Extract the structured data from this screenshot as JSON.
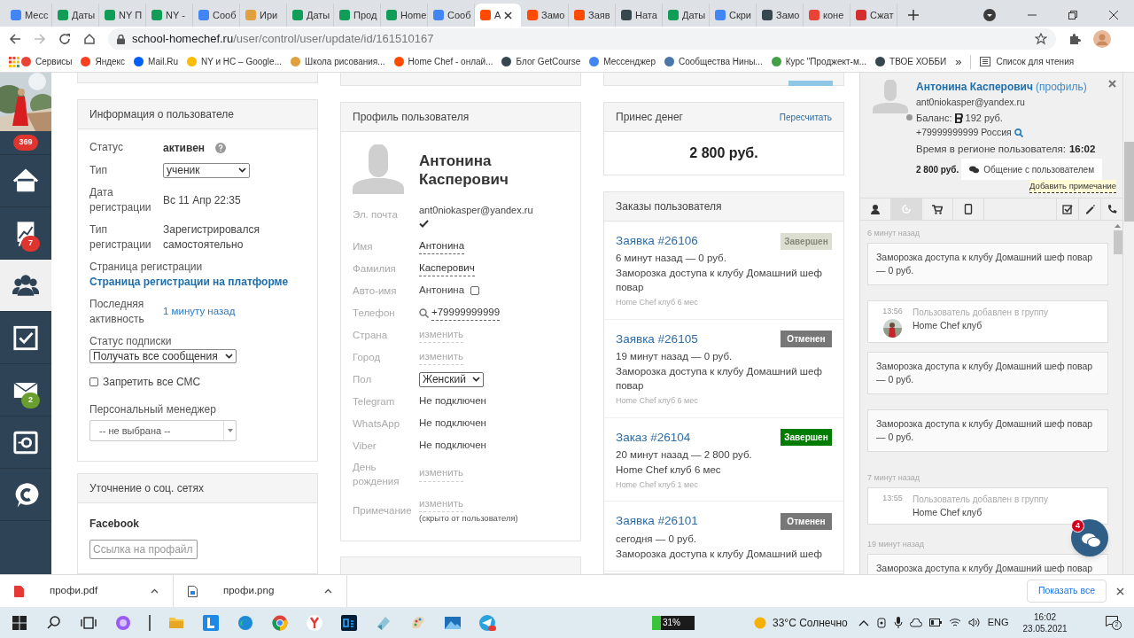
{
  "browser": {
    "tabs": [
      {
        "label": "Месс",
        "color": "#4285f4",
        "selected": false
      },
      {
        "label": "Даты",
        "color": "#0f9d58",
        "selected": false
      },
      {
        "label": "NY П",
        "color": "#0f9d58",
        "selected": false
      },
      {
        "label": "NY -",
        "color": "#0f9d58",
        "selected": false
      },
      {
        "label": "Сооб",
        "color": "#4285f4",
        "selected": false
      },
      {
        "label": "Ири",
        "color": "#e0a040",
        "selected": false
      },
      {
        "label": "Даты",
        "color": "#0f9d58",
        "selected": false
      },
      {
        "label": "Прод",
        "color": "#0f9d58",
        "selected": false
      },
      {
        "label": "Home",
        "color": "#0f9d58",
        "selected": false
      },
      {
        "label": "Сооб",
        "color": "#4285f4",
        "selected": false
      },
      {
        "label": "А",
        "color": "#ff4a00",
        "selected": true
      },
      {
        "label": "Замо",
        "color": "#ff4a00",
        "selected": false
      },
      {
        "label": "Заяв",
        "color": "#ff4a00",
        "selected": false
      },
      {
        "label": "Ната",
        "color": "#37474f",
        "selected": false
      },
      {
        "label": "Даты",
        "color": "#0f9d58",
        "selected": false
      },
      {
        "label": "Скри",
        "color": "#4285f4",
        "selected": false
      },
      {
        "label": "Замо",
        "color": "#37474f",
        "selected": false
      },
      {
        "label": "коне",
        "color": "#ea4335",
        "selected": false
      },
      {
        "label": "Сжат",
        "color": "#d32f2f",
        "selected": false
      }
    ],
    "url_host": "school-homechef.ru",
    "url_path": "/user/control/user/update/id/161510167",
    "bookmarks": [
      {
        "label": "Сервисы",
        "color": "#ea4335"
      },
      {
        "label": "Яндекс",
        "color": "#fc3f1d"
      },
      {
        "label": "Mail.Ru",
        "color": "#005ff9"
      },
      {
        "label": "NY и HC – Google...",
        "color": "#fbbc04"
      },
      {
        "label": "Школа рисования...",
        "color": "#e0a040"
      },
      {
        "label": "Home Chef - онлай...",
        "color": "#ff4a00"
      },
      {
        "label": "Блог GetCourse",
        "color": "#37474f"
      },
      {
        "label": "Мессенджер",
        "color": "#4285f4"
      },
      {
        "label": "Сообщества Нины...",
        "color": "#4a76a8"
      },
      {
        "label": "Курс \"Проджект-м...",
        "color": "#43a047"
      },
      {
        "label": "ТВОЕ ХОББИ",
        "color": "#37474f"
      }
    ],
    "more": "»",
    "reading_list": "Список для чтения"
  },
  "sidebar": {
    "badge": "369",
    "items": [
      {
        "kind": "home",
        "selected": false
      },
      {
        "kind": "chart",
        "badge": "7",
        "color": "#e0342f",
        "selected": false
      },
      {
        "kind": "users",
        "selected": true
      },
      {
        "kind": "tasks",
        "selected": false
      },
      {
        "kind": "mail",
        "badge": "2",
        "color": "#6a9e2e",
        "selected": false
      },
      {
        "kind": "safe",
        "selected": false
      },
      {
        "kind": "chat",
        "selected": false
      }
    ]
  },
  "user_info": {
    "title": "Информация о пользователе",
    "status": {
      "label": "Статус",
      "value": "активен"
    },
    "type": {
      "label": "Тип",
      "value": "ученик"
    },
    "reg_date": {
      "label": "Дата регистрации",
      "value": "Вс 11 Апр 22:35"
    },
    "reg_type": {
      "label": "Тип регистрации",
      "value": "Зарегистрировался самостоятельно"
    },
    "reg_page": {
      "label": "Страница регистрации",
      "link": "Страница регистрации на платформе"
    },
    "last_activity": {
      "label": "Последняя активность",
      "value": "1 минуту назад"
    },
    "subscription": {
      "label": "Статус подписки",
      "value": "Получать все сообщения"
    },
    "ban_sms": {
      "label": "Запретить все СМС",
      "checked": false
    },
    "manager": {
      "label": "Персональный менеджер",
      "value": "-- не выбрана --"
    }
  },
  "social": {
    "title": "Уточнение о соц. сетях",
    "network": "Facebook",
    "placeholder": "Ссылка на профайл"
  },
  "profile": {
    "title": "Профиль пользователя",
    "name": "Антонина Касперович",
    "email_label": "Эл. почта",
    "email": "ant0niokasper@yandex.ru",
    "email_verified": true,
    "fields": [
      {
        "kind": "edit",
        "label": "Имя",
        "value": "Антонина"
      },
      {
        "kind": "edit",
        "label": "Фамилия",
        "value": "Касперович"
      },
      {
        "kind": "auto",
        "label": "Авто-имя",
        "value": "Антонина",
        "checked": false
      },
      {
        "kind": "phone",
        "label": "Телефон",
        "value": "+79999999999"
      },
      {
        "kind": "change",
        "label": "Страна",
        "value": "изменить"
      },
      {
        "kind": "change",
        "label": "Город",
        "value": "изменить"
      },
      {
        "kind": "select",
        "label": "Пол",
        "value": "Женский"
      },
      {
        "kind": "text",
        "label": "Telegram",
        "value": "Не подключен"
      },
      {
        "kind": "text",
        "label": "WhatsApp",
        "value": "Не подключен"
      },
      {
        "kind": "text",
        "label": "Viber",
        "value": "Не подключен"
      },
      {
        "kind": "change",
        "label": "День рождения",
        "value": "изменить"
      },
      {
        "kind": "change",
        "label": "Примечание",
        "value": "изменить",
        "hint": "(скрыто от пользователя)"
      }
    ]
  },
  "money": {
    "title": "Принес денег",
    "action": "Пересчитать",
    "amount": "2 800 руб."
  },
  "orders": {
    "title": "Заказы пользователя",
    "items": [
      {
        "title": "Заявка #26106",
        "status": "Завершен",
        "color": "#dcdfd0",
        "time": "6 минут назад — 0 руб.",
        "description": "Заморозка доступа к клубу Домашний шеф повар",
        "product": "Home Chef клуб 6 мес"
      },
      {
        "title": "Заявка #26105",
        "status": "Отменен",
        "color": "#777777",
        "time": "19 минут назад — 0 руб.",
        "description": "Заморозка доступа к клубу Домашний шеф повар",
        "product": "Home Chef клуб 6 мес"
      },
      {
        "title": "Заказ #26104",
        "status": "Завершен",
        "color": "#007d00",
        "time": "20 минут назад — 2 800 руб.",
        "description": "Home Chef клуб 6 мес",
        "product": "Home Chef клуб 1 мес"
      },
      {
        "title": "Заявка #26101",
        "status": "Отменен",
        "color": "#777777",
        "time": "сегодня — 0 руб.",
        "description": "Заморозка доступа к клубу Домашний шеф"
      }
    ]
  },
  "contact": {
    "name": "Антонина Касперович",
    "profile_link": "(профиль)",
    "email": "ant0niokasper@yandex.ru",
    "balance_label": "Баланс:",
    "balance": "192 руб.",
    "phone": "+79999999999 Россия",
    "time_label": "Время в регионе пользователя:",
    "time": "16:02",
    "total": "2 800 руб.",
    "chat_button": "Общение с пользователем",
    "add_note": "Добавить примечание",
    "tabs": [
      {
        "kind": "user",
        "selected": false
      },
      {
        "kind": "history",
        "selected": true
      },
      {
        "kind": "cart",
        "selected": false
      },
      {
        "kind": "tablet",
        "selected": false
      }
    ],
    "actions": [
      {
        "kind": "check"
      },
      {
        "kind": "pencil"
      },
      {
        "kind": "phone"
      }
    ],
    "feed": [
      {
        "kind": "date",
        "text": "6 минут назад"
      },
      {
        "kind": "event",
        "text": "Заморозка доступа к клубу Домашний шеф повар — 0 руб."
      },
      {
        "kind": "group",
        "time": "13:56",
        "label": "Пользователь добавлен в группу",
        "group": "Home Chef клуб",
        "avatar": true
      },
      {
        "kind": "event",
        "text": "Заморозка доступа к клубу Домашний шеф повар — 0 руб."
      },
      {
        "kind": "event",
        "text": "Заморозка доступа к клубу Домашний шеф повар — 0 руб."
      },
      {
        "kind": "date",
        "text": "7 минут назад"
      },
      {
        "kind": "group",
        "time": "13:55",
        "label": "Пользователь добавлен в группу",
        "group": "Home Chef клуб",
        "avatar": false
      },
      {
        "kind": "date",
        "text": "19 минут назад"
      },
      {
        "kind": "event",
        "text": "Заморозка доступа к клубу Домашний шеф повар"
      }
    ],
    "chat_badge": "4"
  },
  "downloads": {
    "items": [
      {
        "kind": "pdf",
        "name": "профи.pdf"
      },
      {
        "kind": "png",
        "name": "профи.png"
      }
    ],
    "show_all": "Показать все"
  },
  "taskbar": {
    "battery": "31%",
    "weather": "33°C Солнечно",
    "lang": "ENG",
    "time": "16:02",
    "date": "23.05.2021",
    "notifications": "2"
  }
}
